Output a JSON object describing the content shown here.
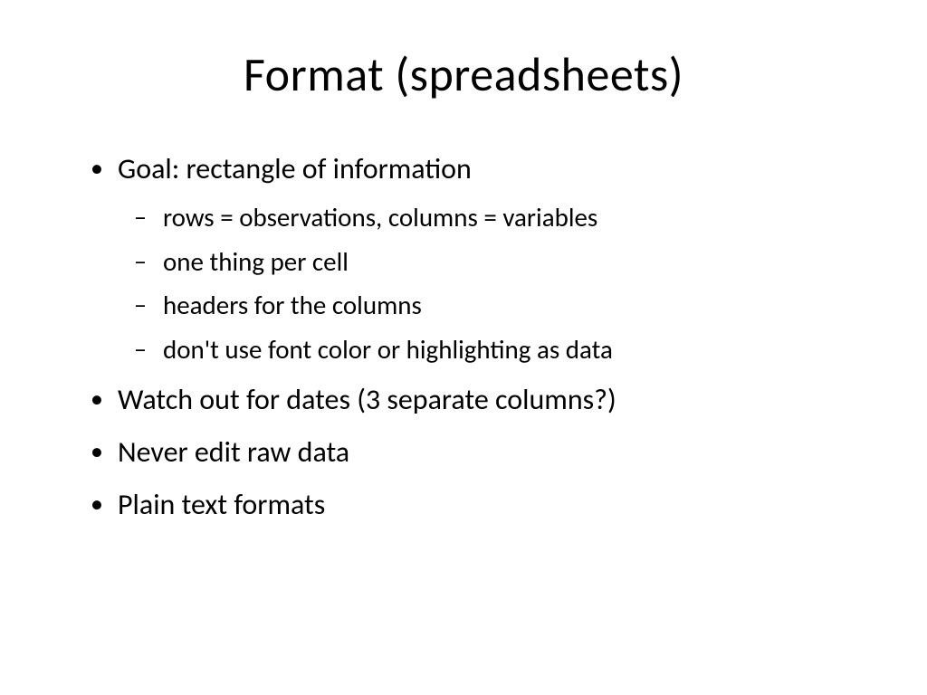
{
  "slide": {
    "title": "Format (spreadsheets)",
    "bullets": {
      "b1": {
        "text": "Goal: rectangle of information",
        "sub": {
          "s1": "rows = observations, columns = variables",
          "s2": "one thing per cell",
          "s3": "headers for the columns",
          "s4": "don't use font color or highlighting as data"
        }
      },
      "b2": {
        "text": "Watch out for dates (3 separate columns?)"
      },
      "b3": {
        "text": "Never edit raw data"
      },
      "b4": {
        "text": "Plain text formats"
      }
    }
  }
}
